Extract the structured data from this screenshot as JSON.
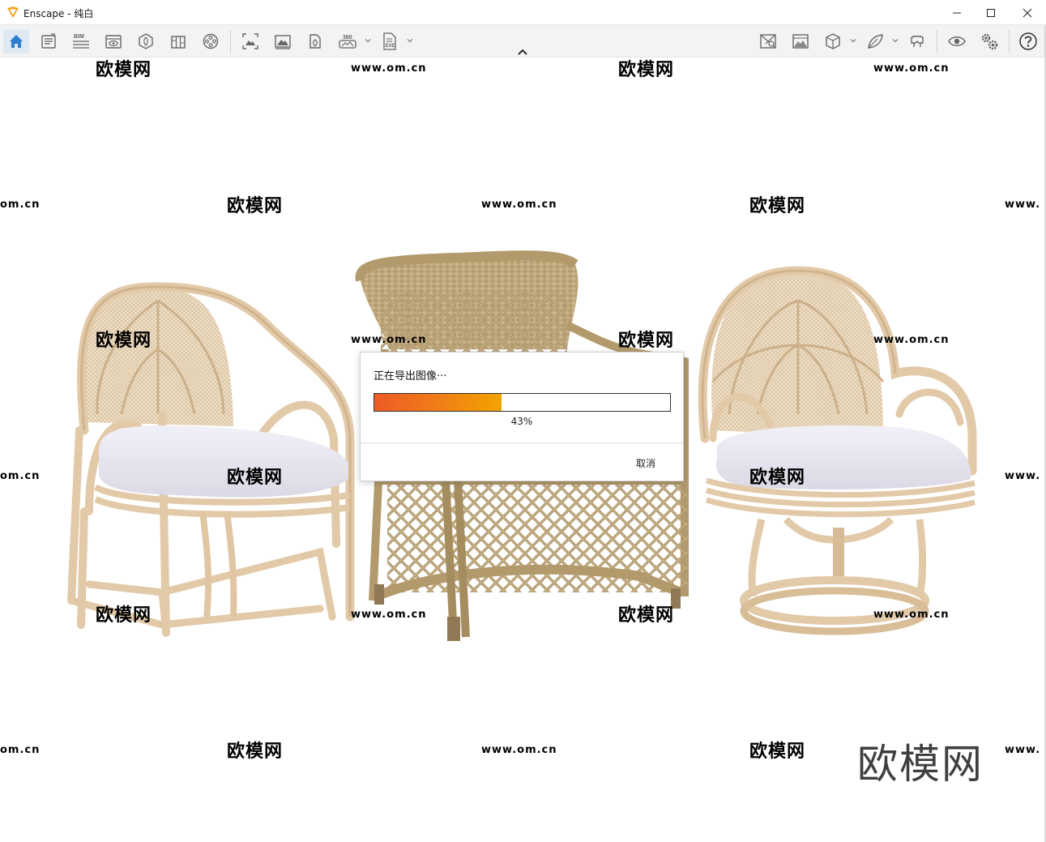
{
  "window": {
    "title": "Enscape - 纯白"
  },
  "toolbar": {
    "left_tools": [
      {
        "name": "home-icon",
        "active": true
      },
      {
        "name": "asset-library-icon"
      },
      {
        "name": "bim-icon",
        "text": "BIM"
      },
      {
        "name": "view-management-icon"
      },
      {
        "name": "site-context-icon"
      },
      {
        "name": "material-editor-icon"
      },
      {
        "name": "video-editor-icon"
      },
      {
        "name": "screenshot-icon"
      },
      {
        "name": "batch-render-icon"
      },
      {
        "name": "panorama-icon"
      },
      {
        "name": "panorama-360-icon",
        "text": "360"
      },
      {
        "name": "exe-export-icon",
        "text": "EXE"
      }
    ],
    "right_tools": [
      {
        "name": "map-icon"
      },
      {
        "name": "atmosphere-icon"
      },
      {
        "name": "cube-view-icon"
      },
      {
        "name": "visual-settings-icon"
      },
      {
        "name": "vr-headset-icon"
      },
      {
        "name": "eye-icon"
      },
      {
        "name": "settings-gears-icon"
      },
      {
        "name": "help-icon"
      }
    ]
  },
  "watermark": {
    "brand": "欧模网",
    "url": "www.om.cn",
    "url_partial": "om.cn",
    "url_partial_right": "www."
  },
  "dialog": {
    "title": "正在导出图像···",
    "progress_fraction": 0.43,
    "progress_text": "43%",
    "cancel_label": "取消"
  },
  "colors": {
    "accent": "#2f7fd1",
    "progress_start": "#ee5a24",
    "progress_end": "#f2a300",
    "rattan": "#e2c9a8",
    "wicker": "#b9a276",
    "cushion": "#eceaf2"
  }
}
